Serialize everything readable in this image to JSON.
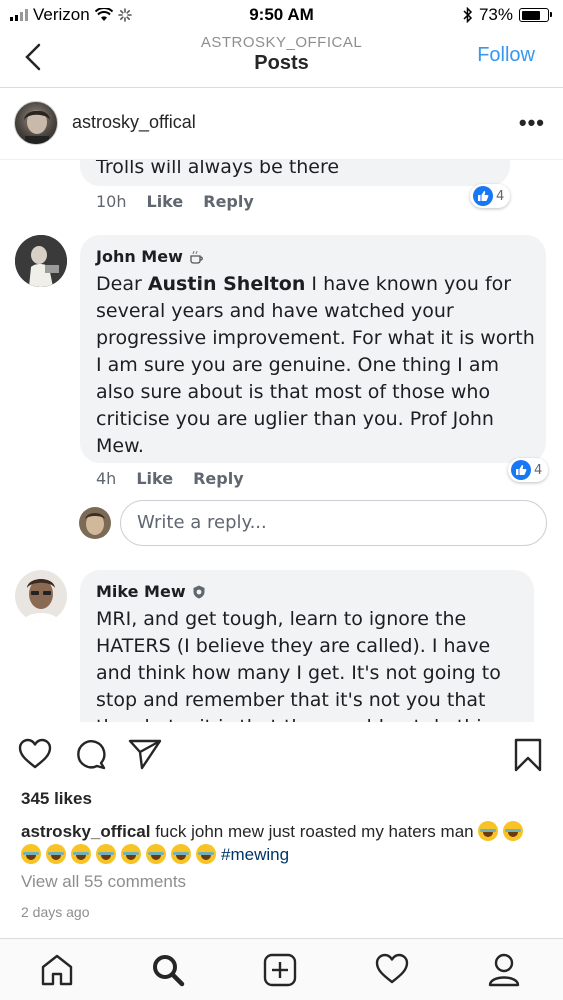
{
  "status_bar": {
    "carrier": "Verizon",
    "time": "9:50 AM",
    "battery": "73%",
    "battery_level": 0.73
  },
  "nav": {
    "subtitle": "ASTROSKY_OFFICAL",
    "title": "Posts",
    "follow_label": "Follow"
  },
  "post": {
    "username": "astrosky_offical",
    "likes": "345 likes",
    "caption_user": "astrosky_offical",
    "caption_text": "fuck  john mew just roasted my haters man",
    "emoji_count": 10,
    "hashtag": "#mewing",
    "view_comments": "View all 55 comments",
    "time_ago": "2 days ago"
  },
  "screenshot": {
    "first_comment_text": "Trolls will always be there",
    "first_comment_time": "10h",
    "first_comment_reactions": "4",
    "like_label": "Like",
    "reply_label": "Reply",
    "john": {
      "name": "John Mew",
      "text_before": "Dear ",
      "mention": "Austin Shelton",
      "text_after": " I have known you for several years and have watched your progressive improvement. For what it is worth I am sure you are genuine. One thing I am also sure about is that most of those who criticise you are uglier than you. Prof John Mew.",
      "time": "4h",
      "reactions": "4"
    },
    "reply_placeholder": "Write a reply...",
    "mike": {
      "name": "Mike Mew",
      "text": "MRI, and get tough, learn to ignore the HATERS (I believe they are called).  I have and think how many I get.   It's not going to stop and remember that it's not you that they hate, it is that they could not do this"
    }
  }
}
